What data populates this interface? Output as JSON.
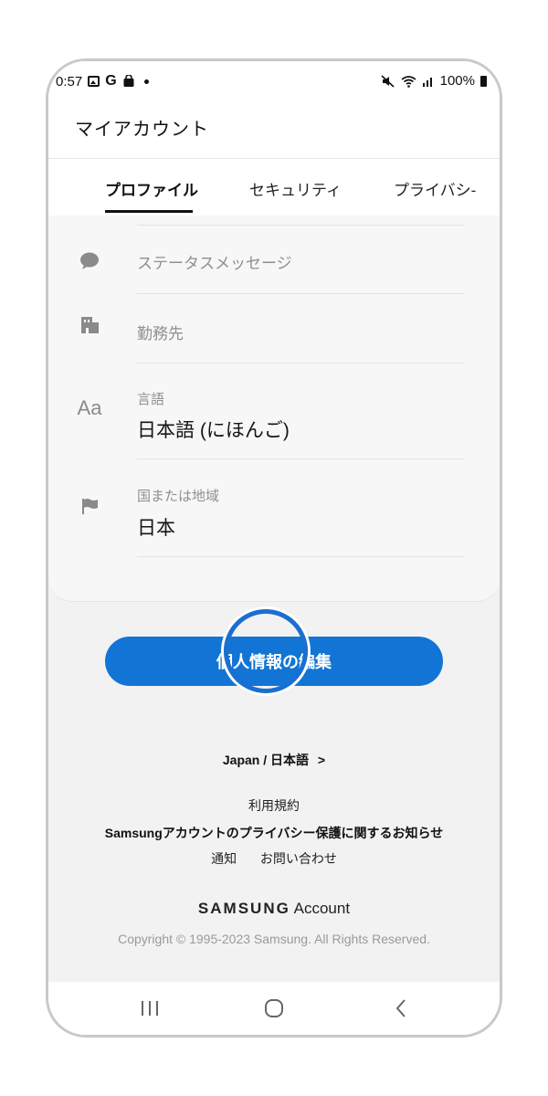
{
  "status": {
    "time": "0:57",
    "battery": "100%",
    "icons_left": [
      "photo-icon",
      "google-icon",
      "shopping-bag-icon",
      "dot-icon"
    ],
    "icons_right": [
      "mute-icon",
      "wifi-icon",
      "signal-icon",
      "battery-icon"
    ]
  },
  "appbar": {
    "title": "マイアカウント"
  },
  "tabs": [
    {
      "label": "プロファイル",
      "active": true
    },
    {
      "label": "セキュリティ",
      "active": false
    },
    {
      "label": "プライバシ-",
      "active": false
    }
  ],
  "profile": {
    "status_message": {
      "label": "ステータスメッセージ",
      "icon": "speech-bubble-icon"
    },
    "workplace": {
      "label": "勤務先",
      "icon": "building-icon"
    },
    "language": {
      "label": "言語",
      "value": "日本語 (にほんご)",
      "icon": "aa-icon",
      "icon_text": "Aa"
    },
    "region": {
      "label": "国または地域",
      "value": "日本",
      "icon": "flag-icon"
    }
  },
  "edit_button": {
    "label": "個人情報の編集"
  },
  "footer": {
    "locale_link": "Japan / 日本語",
    "locale_chevron": ">",
    "terms": "利用規約",
    "privacy": "Samsungアカウントのプライバシー保護に関するお知らせ",
    "notice": "通知",
    "contact": "お問い合わせ",
    "brand_mark": "SAMSUNG",
    "brand_suffix": "Account",
    "copyright": "Copyright © 1995-2023 Samsung. All Rights Reserved."
  },
  "colors": {
    "accent": "#1275d5",
    "ring": "#1a6fd0"
  }
}
